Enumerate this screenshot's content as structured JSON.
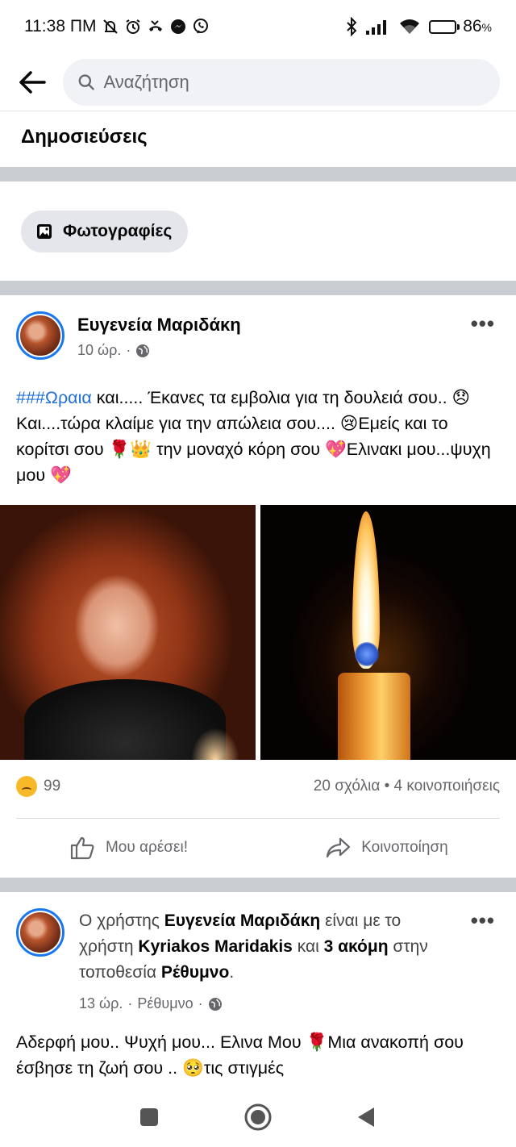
{
  "status_bar": {
    "time": "11:38 ΠΜ",
    "battery": "86",
    "battery_suffix": "%",
    "battery_level": 0.86
  },
  "search": {
    "placeholder": "Αναζήτηση"
  },
  "section_title": "Δημοσιεύσεις",
  "filter_chip": {
    "label": "Φωτογραφίες",
    "icon": "photos-icon"
  },
  "post1": {
    "author": "Ευγενεία Μαριδάκη",
    "time": "10 ώρ.",
    "separator": "·",
    "privacy_icon": "globe-icon",
    "text_hashtag": "###Ωραια",
    "text_rest": " και..... Έκανες τα εμβολια για τη δουλειά σου.. 😞Και....τώρα κλαίμε για την απώλεια σου.... 😢Εμείς και το κορίτσι σου 🌹👑 την μοναχό κόρη σου 💖Ελινακι μου...ψυχη μου 💖",
    "reaction_count": "99",
    "comments_shares": "20 σχόλια • 4 κοινοποιήσεις",
    "like_label": "Μου αρέσει!",
    "share_label": "Κοινοποίηση"
  },
  "post2": {
    "prefix": "Ο χρήστης ",
    "author": "Ευγενεία Μαριδάκη",
    "mid1": " είναι με το χρήστη ",
    "tagged": "Kyriakos Maridakis",
    "mid2": " και ",
    "others": "3 ακόμη",
    "mid3": " στην τοποθεσία ",
    "place": "Ρέθυμνο",
    "end": ".",
    "time": "13 ώρ.",
    "separator": "·",
    "location": "Ρέθυμνο",
    "privacy_icon": "globe-icon",
    "text": "Αδερφή μου.. Ψυχή μου... Ελινα Μου 🌹Μια ανακοπή σου έσβησε τη ζωή σου .. 🥺τις στιγμές"
  },
  "colors": {
    "facebook_blue": "#1877f2",
    "hashtag_blue": "#216fdb",
    "secondary_text": "#65676b",
    "divider_gray": "#c9ccd1"
  }
}
